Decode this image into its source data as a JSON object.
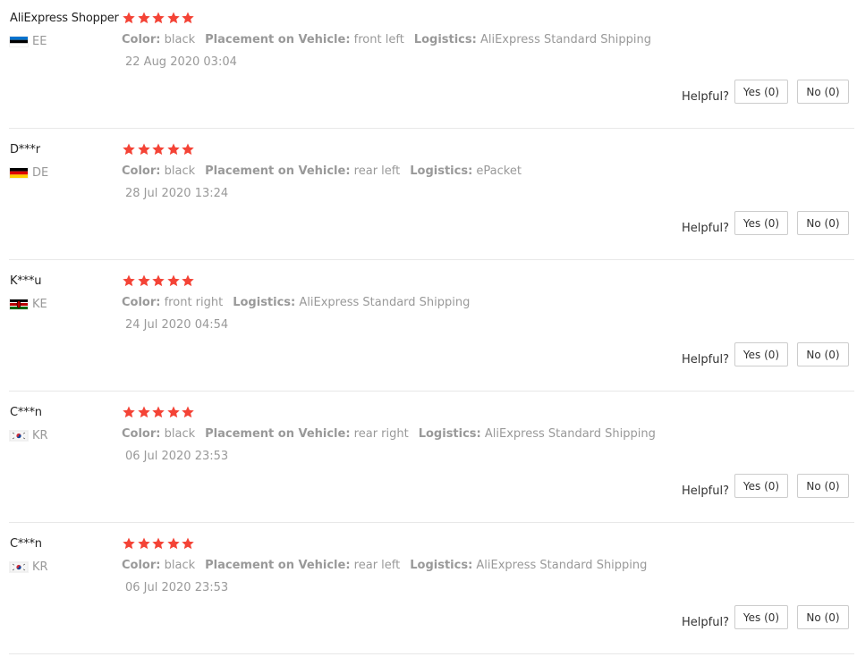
{
  "helpful_label": "Helpful?",
  "colors": {
    "star": "#f44336",
    "text_muted": "#999999",
    "text_dark": "#222222"
  },
  "reviews": [
    {
      "user": "AliExpress Shopper",
      "country": "EE",
      "flag": "flag-ee-icon",
      "rating": 5,
      "attributes": [
        {
          "key": "Color:",
          "value": "black"
        },
        {
          "key": "Placement on Vehicle:",
          "value": "front left"
        },
        {
          "key": "Logistics:",
          "value": "AliExpress Standard Shipping"
        }
      ],
      "date": "22 Aug 2020 03:04",
      "yes_label": "Yes (0)",
      "no_label": "No (0)"
    },
    {
      "user": "D***r",
      "country": "DE",
      "flag": "flag-de-icon",
      "rating": 5,
      "attributes": [
        {
          "key": "Color:",
          "value": "black"
        },
        {
          "key": "Placement on Vehicle:",
          "value": "rear left"
        },
        {
          "key": "Logistics:",
          "value": "ePacket"
        }
      ],
      "date": "28 Jul 2020 13:24",
      "yes_label": "Yes (0)",
      "no_label": "No (0)"
    },
    {
      "user": "K***u",
      "country": "KE",
      "flag": "flag-ke-icon",
      "rating": 5,
      "attributes": [
        {
          "key": "Color:",
          "value": "front right"
        },
        {
          "key": "Logistics:",
          "value": "AliExpress Standard Shipping"
        }
      ],
      "date": "24 Jul 2020 04:54",
      "yes_label": "Yes (0)",
      "no_label": "No (0)"
    },
    {
      "user": "C***n",
      "country": "KR",
      "flag": "flag-kr-icon",
      "rating": 5,
      "attributes": [
        {
          "key": "Color:",
          "value": "black"
        },
        {
          "key": "Placement on Vehicle:",
          "value": "rear right"
        },
        {
          "key": "Logistics:",
          "value": "AliExpress Standard Shipping"
        }
      ],
      "date": "06 Jul 2020 23:53",
      "yes_label": "Yes (0)",
      "no_label": "No (0)"
    },
    {
      "user": "C***n",
      "country": "KR",
      "flag": "flag-kr-icon",
      "rating": 5,
      "attributes": [
        {
          "key": "Color:",
          "value": "black"
        },
        {
          "key": "Placement on Vehicle:",
          "value": "rear left"
        },
        {
          "key": "Logistics:",
          "value": "AliExpress Standard Shipping"
        }
      ],
      "date": "06 Jul 2020 23:53",
      "yes_label": "Yes (0)",
      "no_label": "No (0)"
    }
  ]
}
